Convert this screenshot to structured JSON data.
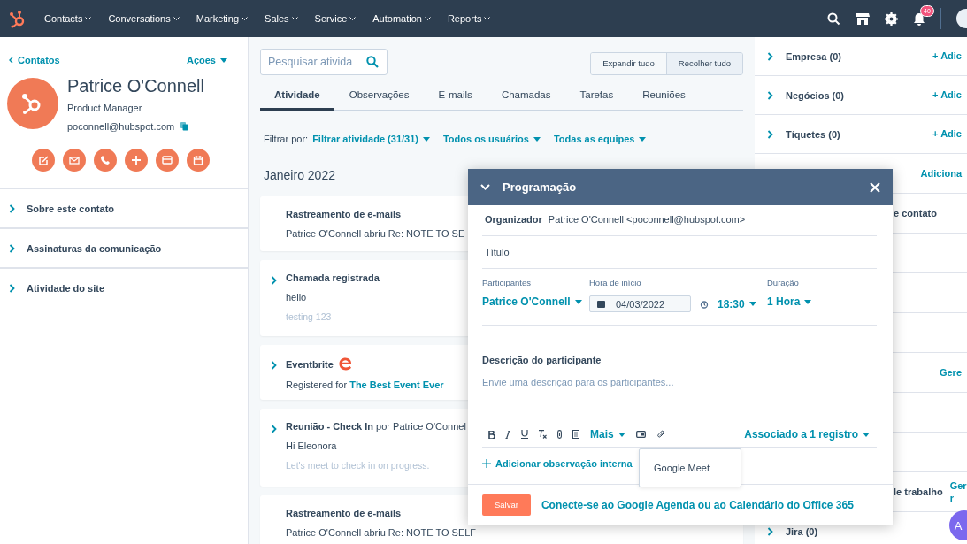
{
  "nav": {
    "items": [
      {
        "label": "Contacts"
      },
      {
        "label": "Conversations"
      },
      {
        "label": "Marketing"
      },
      {
        "label": "Sales"
      },
      {
        "label": "Service"
      },
      {
        "label": "Automation"
      },
      {
        "label": "Reports"
      }
    ],
    "badge": "40"
  },
  "contact": {
    "back": "Contatos",
    "actions": "Ações",
    "name": "Patrice O'Connell",
    "job": "Product Manager",
    "email": "poconnell@hubspot.com",
    "sections": [
      {
        "label": "Sobre este contato",
        "expanded": false
      },
      {
        "label": "Assinaturas da comunicação",
        "expanded": false
      },
      {
        "label": "Atividade do site",
        "expanded": false
      }
    ]
  },
  "activity": {
    "search_placeholder": "Pesquisar ativida",
    "toggles": [
      {
        "label": "Expandir tudo",
        "selected": false
      },
      {
        "label": "Recolher tudo",
        "selected": true
      }
    ],
    "tabs": [
      {
        "label": "Atividade",
        "selected": true
      },
      {
        "label": "Observações",
        "selected": false
      },
      {
        "label": "E-mails",
        "selected": false
      },
      {
        "label": "Chamadas",
        "selected": false
      },
      {
        "label": "Tarefas",
        "selected": false
      },
      {
        "label": "Reuniões",
        "selected": false
      }
    ],
    "filter_label": "Filtrar por:",
    "filters": [
      "Filtrar atividade (31/31)",
      "Todos os usuários",
      "Todas as equipes"
    ],
    "month": "Janeiro 2022",
    "cards": [
      {
        "kind": "email",
        "expandable": false,
        "title": "Rastreamento de e-mails",
        "lines": [
          {
            "kind": "body",
            "text": "Patrice O'Connell abriu Re: NOTE TO SE"
          }
        ]
      },
      {
        "kind": "call",
        "expandable": true,
        "title": "Chamada registrada",
        "lines": [
          {
            "kind": "body",
            "text": "hello"
          },
          {
            "kind": "muted",
            "text": "testing 123"
          }
        ]
      },
      {
        "kind": "integration",
        "expandable": true,
        "title": "Eventbrite",
        "lines": [
          {
            "kind": "body",
            "text": "Registered for **The Best Event Ever**"
          }
        ]
      },
      {
        "kind": "meeting",
        "expandable": true,
        "title": "Reunião - Check In",
        "byline": "por Patrice O'Connel",
        "lines": [
          {
            "kind": "body",
            "text": "Hi Eleonora"
          },
          {
            "kind": "muted",
            "text": "Let's meet to check in on progress."
          }
        ]
      },
      {
        "kind": "email",
        "expandable": false,
        "title": "Rastreamento de e-mails",
        "lines": [
          {
            "kind": "body",
            "text": "Patrice O'Connell abriu Re: NOTE TO SELF"
          }
        ]
      }
    ]
  },
  "sidebar": {
    "rows": [
      {
        "kind": "section",
        "label": "Empresa (0)",
        "link": "+ Adic"
      },
      {
        "kind": "section",
        "label": "Negócios (0)",
        "link": "+ Adic"
      },
      {
        "kind": "section",
        "label": "Tíquetes (0)",
        "link": "+ Adic"
      },
      {
        "kind": "partial",
        "link": "Adiciona"
      },
      {
        "kind": "partial",
        "label": "e contato"
      },
      {
        "kind": "partial"
      },
      {
        "kind": "partial"
      },
      {
        "kind": "partial"
      },
      {
        "kind": "partial",
        "link": "Gere"
      },
      {
        "kind": "partial"
      },
      {
        "kind": "partial"
      },
      {
        "kind": "partial",
        "label": "le trabalho",
        "link": "Ger r"
      },
      {
        "kind": "section",
        "label": "Jira (0)"
      }
    ],
    "help_label": "A"
  },
  "modal": {
    "title": "Programação",
    "organizer_label": "Organizador",
    "organizer": "Patrice O'Connell <poconnell@hubspot.com>",
    "title_placeholder": "Título",
    "participants_label": "Participantes",
    "participant": "Patrice O'Connell",
    "start_label": "Hora de início",
    "date": "04/03/2022",
    "time": "18:30",
    "duration_label": "Duração",
    "duration": "1 Hora",
    "description_label": "Descrição do participante",
    "description_placeholder": "Envie uma descrição para os participantes...",
    "more": "Mais",
    "associated": "Associado a 1 registro",
    "add_note": "Adicionar observação interna",
    "popup": "Google Meet",
    "save": "Salvar",
    "connect": "Conecte-se ao Google Agenda ou ao Calendário do Office 365"
  }
}
